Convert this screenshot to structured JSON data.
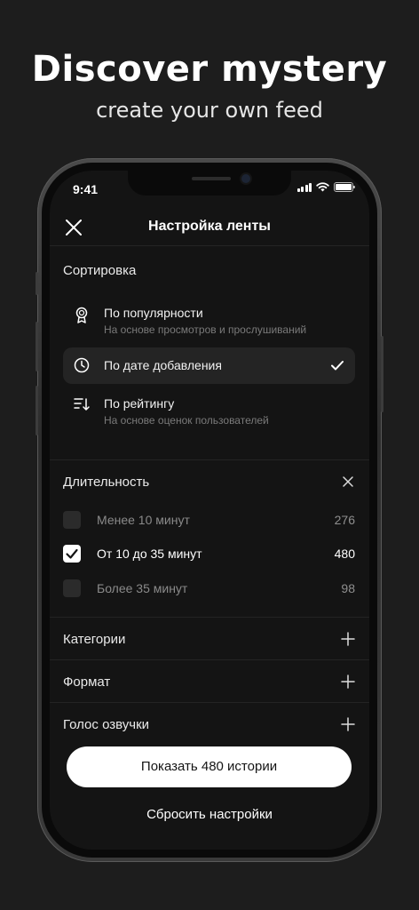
{
  "promo": {
    "title": "Discover mystery",
    "subtitle": "create your own feed"
  },
  "status_bar": {
    "time": "9:41",
    "icons": [
      "signal-icon",
      "wifi-icon",
      "battery-icon"
    ]
  },
  "header": {
    "title": "Настройка ленты",
    "close_icon": "close-icon"
  },
  "sort": {
    "title": "Сортировка",
    "options": [
      {
        "label": "По популярности",
        "subtitle": "На основе просмотров и прослушиваний",
        "icon": "award-icon",
        "selected": false
      },
      {
        "label": "По дате добавления",
        "subtitle": "",
        "icon": "clock-icon",
        "selected": true
      },
      {
        "label": "По рейтингу",
        "subtitle": "На основе оценок пользователей",
        "icon": "sort-rating-icon",
        "selected": false
      }
    ]
  },
  "duration": {
    "title": "Длительность",
    "options": [
      {
        "label": "Менее 10 минут",
        "count": "276",
        "checked": false
      },
      {
        "label": "От 10 до 35 минут",
        "count": "480",
        "checked": true
      },
      {
        "label": "Более 35 минут",
        "count": "98",
        "checked": false
      }
    ]
  },
  "filters": [
    {
      "label": "Категории"
    },
    {
      "label": "Формат"
    },
    {
      "label": "Голос озвучки"
    }
  ],
  "actions": {
    "show_button": "Показать 480 истории",
    "reset_button": "Сбросить настройки"
  },
  "colors": {
    "background": "#1d1d1d",
    "screen": "#141414",
    "selected_row": "#242424",
    "primary_button": "#ffffff"
  }
}
